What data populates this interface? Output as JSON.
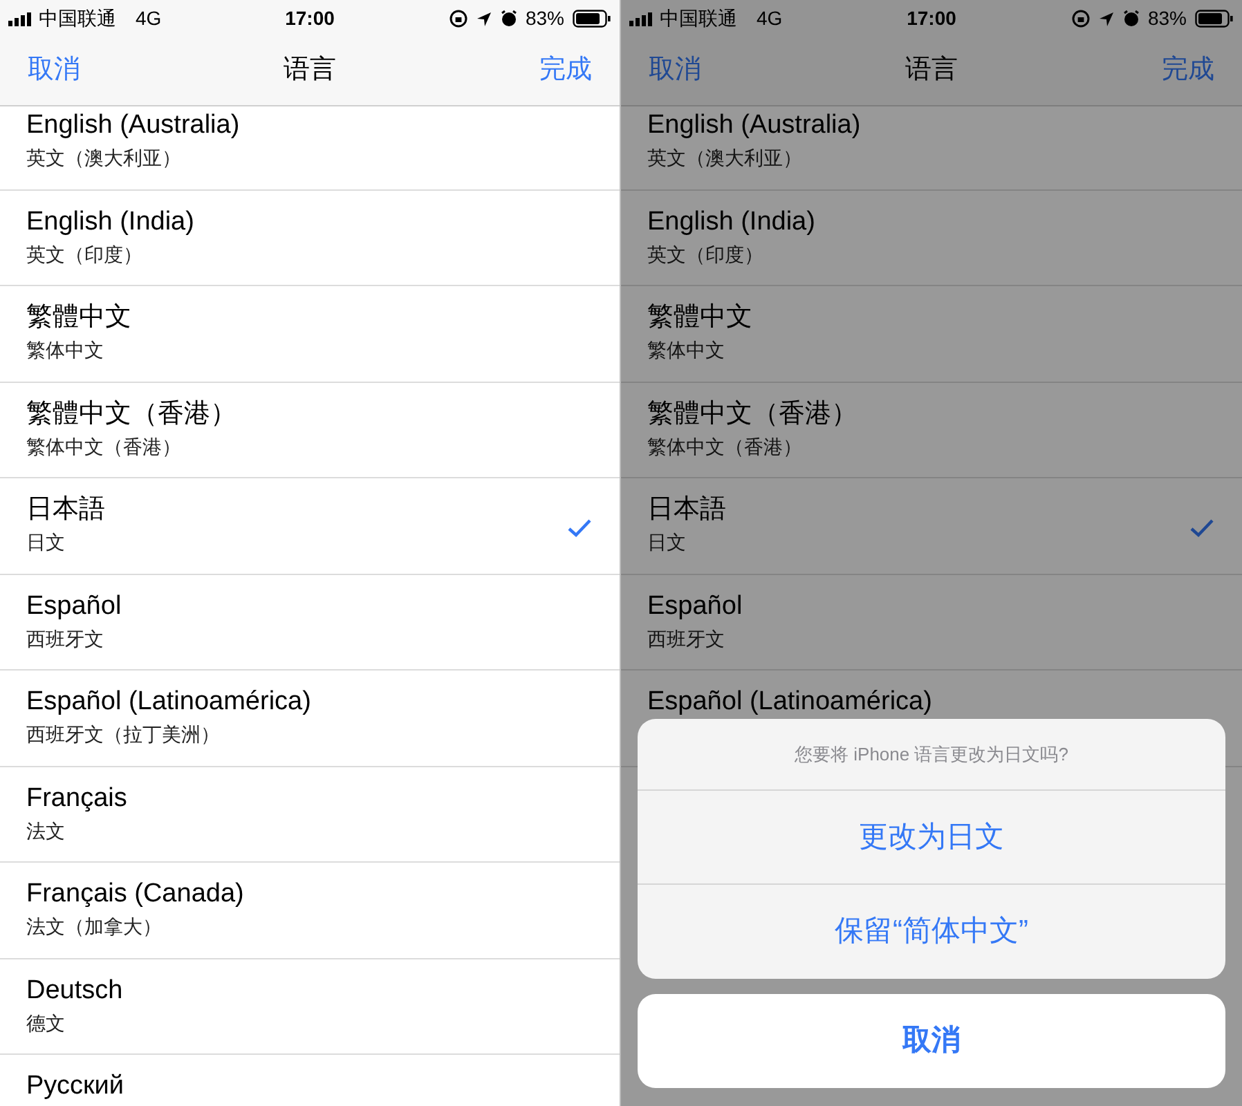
{
  "panels": [
    {
      "status_bar": {
        "carrier": "中国联通",
        "network": "4G",
        "time": "17:00",
        "battery": "83%"
      },
      "nav": {
        "left": "取消",
        "title": "语言",
        "right": "完成"
      },
      "rows_above": [
        {
          "title": "English (Australia)",
          "subtitle": "英文（澳大利亚）",
          "selected": false
        },
        {
          "title": "English (India)",
          "subtitle": "英文（印度）",
          "selected": false
        },
        {
          "title": "繁體中文",
          "subtitle": "繁体中文",
          "selected": false
        },
        {
          "title": "繁體中文（香港）",
          "subtitle": "繁体中文（香港）",
          "selected": false
        },
        {
          "title": "日本語",
          "subtitle": "日文",
          "selected": true
        },
        {
          "title": "Español",
          "subtitle": "西班牙文",
          "selected": false
        },
        {
          "title": "Español (Latinoamérica)",
          "subtitle": "西班牙文（拉丁美洲）",
          "selected": false
        },
        {
          "title": "Français",
          "subtitle": "法文",
          "selected": false
        },
        {
          "title": "Français (Canada)",
          "subtitle": "法文（加拿大）",
          "selected": false
        },
        {
          "title": "Deutsch",
          "subtitle": "德文",
          "selected": false
        },
        {
          "title": "Русский",
          "selected": false
        }
      ]
    },
    {
      "status_bar": {
        "carrier": "中国联通",
        "network": "4G",
        "time": "17:00",
        "battery": "83%"
      },
      "nav": {
        "left": "取消",
        "title": "语言",
        "right": "完成"
      },
      "rows_above": [
        {
          "title": "English (Australia)",
          "subtitle": "英文（澳大利亚）",
          "selected": false
        },
        {
          "title": "English (India)",
          "subtitle": "英文（印度）",
          "selected": false
        },
        {
          "title": "繁體中文",
          "subtitle": "繁体中文",
          "selected": false
        },
        {
          "title": "繁體中文（香港）",
          "subtitle": "繁体中文（香港）",
          "selected": false
        },
        {
          "title": "日本語",
          "subtitle": "日文",
          "selected": true
        },
        {
          "title": "Español",
          "subtitle": "西班牙文",
          "selected": false
        },
        {
          "title": "Español (Latinoamérica)",
          "selected": false
        }
      ],
      "action_sheet": {
        "message": "您要将 iPhone 语言更改为日文吗?",
        "actions": [
          "更改为日文",
          "保留“简体中文”"
        ],
        "cancel": "取消"
      }
    }
  ]
}
